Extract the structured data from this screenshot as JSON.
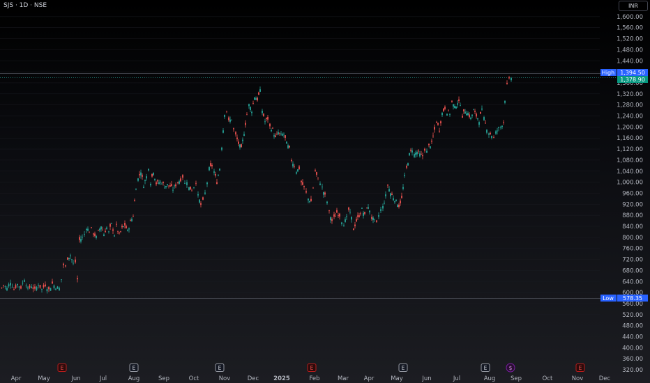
{
  "header": {
    "title": "SJS · 1D · NSE",
    "currency": "INR"
  },
  "colors": {
    "up": "#26a69a",
    "down": "#ef5350",
    "high_tag": "#2962ff",
    "last_tag": "#089981",
    "event_earn": "#b71c1c",
    "event_div": "#7b1fa2"
  },
  "chart_data": {
    "type": "candlestick",
    "ylim": [
      305,
      1635
    ],
    "y_ticks": [
      "320.00",
      "360.00",
      "400.00",
      "440.00",
      "480.00",
      "520.00",
      "560.00",
      "600.00",
      "640.00",
      "680.00",
      "720.00",
      "760.00",
      "800.00",
      "840.00",
      "880.00",
      "920.00",
      "960.00",
      "1,000.00",
      "1,040.00",
      "1,080.00",
      "1,120.00",
      "1,160.00",
      "1,200.00",
      "1,240.00",
      "1,280.00",
      "1,320.00",
      "1,360.00",
      "1,400.00",
      "1,440.00",
      "1,480.00",
      "1,520.00",
      "1,560.00",
      "1,600.00"
    ],
    "x_ticks": [
      "Apr",
      "May",
      "Jun",
      "Jul",
      "Aug",
      "Sep",
      "Oct",
      "Nov",
      "Dec",
      "2025",
      "Feb",
      "Mar",
      "Apr",
      "May",
      "Jun",
      "Jul",
      "Aug",
      "Sep",
      "Oct",
      "Nov",
      "Dec"
    ],
    "high": {
      "label": "High",
      "value": "1,394.50"
    },
    "low": {
      "label": "Low",
      "value": "578.35"
    },
    "last": {
      "value": "1,378.90"
    },
    "events": [
      {
        "type": "earnings",
        "label": "E",
        "filled": true
      },
      {
        "type": "earnings",
        "label": "E",
        "filled": false
      },
      {
        "type": "earnings",
        "label": "E",
        "filled": false
      },
      {
        "type": "earnings",
        "label": "E",
        "filled": true
      },
      {
        "type": "earnings",
        "label": "E",
        "filled": false
      },
      {
        "type": "earnings",
        "label": "E",
        "filled": false
      },
      {
        "type": "dividend",
        "label": "$",
        "filled": true
      },
      {
        "type": "earnings",
        "label": "E",
        "filled": true
      }
    ],
    "series": [
      {
        "name": "",
        "values": [
          [
            0,
            605
          ],
          [
            5,
            628
          ],
          [
            10,
            615
          ],
          [
            15,
            640
          ],
          [
            20,
            612
          ],
          [
            25,
            630
          ],
          [
            30,
            618
          ],
          [
            35,
            650
          ],
          [
            40,
            612
          ],
          [
            45,
            625
          ],
          [
            50,
            608
          ],
          [
            55,
            630
          ],
          [
            60,
            612
          ],
          [
            65,
            628
          ],
          [
            70,
            610
          ],
          [
            75,
            632
          ],
          [
            80,
            620
          ],
          [
            85,
            615
          ],
          [
            88,
            648
          ],
          [
            91,
            700
          ],
          [
            94,
            692
          ],
          [
            97,
            725
          ],
          [
            101,
            735
          ],
          [
            105,
            705
          ],
          [
            108,
            710
          ],
          [
            111,
            648
          ],
          [
            114,
            790
          ],
          [
            118,
            800
          ],
          [
            121,
            812
          ],
          [
            124,
            836
          ],
          [
            128,
            822
          ],
          [
            131,
            830
          ],
          [
            134,
            815
          ],
          [
            138,
            800
          ],
          [
            141,
            820
          ],
          [
            145,
            842
          ],
          [
            149,
            812
          ],
          [
            153,
            835
          ],
          [
            156,
            818
          ],
          [
            160,
            848
          ],
          [
            164,
            810
          ],
          [
            167,
            840
          ],
          [
            171,
            808
          ],
          [
            175,
            832
          ],
          [
            179,
            845
          ],
          [
            183,
            822
          ],
          [
            187,
            855
          ],
          [
            191,
            880
          ],
          [
            195,
            980
          ],
          [
            198,
            1012
          ],
          [
            202,
            1040
          ],
          [
            206,
            990
          ],
          [
            210,
            1020
          ],
          [
            213,
            1055
          ],
          [
            216,
            1000
          ],
          [
            220,
            1040
          ],
          [
            224,
            995
          ],
          [
            228,
            1000
          ],
          [
            232,
            1000
          ],
          [
            236,
            985
          ],
          [
            240,
            990
          ],
          [
            244,
            985
          ],
          [
            248,
            975
          ],
          [
            252,
            990
          ],
          [
            255,
            1000
          ],
          [
            259,
            1010
          ],
          [
            262,
            1020
          ],
          [
            265,
            995
          ],
          [
            268,
            1005
          ],
          [
            271,
            980
          ],
          [
            275,
            972
          ],
          [
            278,
            985
          ],
          [
            281,
            1002
          ],
          [
            284,
            950
          ],
          [
            288,
            918
          ],
          [
            291,
            930
          ],
          [
            294,
            960
          ],
          [
            297,
            1000
          ],
          [
            300,
            1048
          ],
          [
            304,
            1060
          ],
          [
            307,
            1038
          ],
          [
            311,
            1000
          ],
          [
            315,
            1050
          ],
          [
            318,
            1130
          ],
          [
            322,
            1250
          ],
          [
            325,
            1260
          ],
          [
            328,
            1220
          ],
          [
            332,
            1230
          ],
          [
            335,
            1190
          ],
          [
            338,
            1170
          ],
          [
            342,
            1140
          ],
          [
            346,
            1120
          ],
          [
            350,
            1180
          ],
          [
            354,
            1245
          ],
          [
            357,
            1280
          ],
          [
            361,
            1260
          ],
          [
            365,
            1310
          ],
          [
            369,
            1300
          ],
          [
            373,
            1330
          ],
          [
            376,
            1260
          ],
          [
            380,
            1220
          ],
          [
            384,
            1230
          ],
          [
            387,
            1200
          ],
          [
            391,
            1190
          ],
          [
            395,
            1160
          ],
          [
            399,
            1180
          ],
          [
            403,
            1170
          ],
          [
            407,
            1175
          ],
          [
            411,
            1140
          ],
          [
            415,
            1120
          ],
          [
            418,
            1080
          ],
          [
            422,
            1060
          ],
          [
            425,
            1040
          ],
          [
            429,
            1050
          ],
          [
            432,
            1000
          ],
          [
            436,
            980
          ],
          [
            439,
            960
          ],
          [
            442,
            940
          ],
          [
            446,
            930
          ],
          [
            449,
            980
          ],
          [
            452,
            1040
          ],
          [
            456,
            1010
          ],
          [
            459,
            1000
          ],
          [
            462,
            980
          ],
          [
            466,
            950
          ],
          [
            469,
            930
          ],
          [
            472,
            890
          ],
          [
            476,
            860
          ],
          [
            479,
            870
          ],
          [
            483,
            890
          ],
          [
            487,
            880
          ],
          [
            490,
            860
          ],
          [
            493,
            850
          ],
          [
            497,
            870
          ],
          [
            500,
            900
          ],
          [
            504,
            870
          ],
          [
            507,
            830
          ],
          [
            511,
            860
          ],
          [
            515,
            880
          ],
          [
            519,
            900
          ],
          [
            523,
            880
          ],
          [
            526,
            910
          ],
          [
            530,
            900
          ],
          [
            533,
            870
          ],
          [
            537,
            860
          ],
          [
            540,
            850
          ],
          [
            543,
            880
          ],
          [
            546,
            900
          ],
          [
            549,
            910
          ],
          [
            553,
            950
          ],
          [
            556,
            990
          ],
          [
            560,
            960
          ],
          [
            564,
            945
          ],
          [
            568,
            930
          ],
          [
            572,
            915
          ],
          [
            576,
            940
          ],
          [
            580,
            1020
          ],
          [
            583,
            1050
          ],
          [
            587,
            1100
          ],
          [
            591,
            1120
          ],
          [
            594,
            1100
          ],
          [
            598,
            1110
          ],
          [
            602,
            1100
          ],
          [
            606,
            1095
          ],
          [
            609,
            1120
          ],
          [
            612,
            1110
          ],
          [
            615,
            1130
          ],
          [
            619,
            1140
          ],
          [
            623,
            1190
          ],
          [
            626,
            1220
          ],
          [
            630,
            1190
          ],
          [
            634,
            1250
          ],
          [
            638,
            1270
          ],
          [
            641,
            1255
          ],
          [
            645,
            1250
          ],
          [
            648,
            1290
          ],
          [
            652,
            1270
          ],
          [
            656,
            1290
          ],
          [
            660,
            1285
          ],
          [
            663,
            1240
          ],
          [
            667,
            1260
          ],
          [
            671,
            1250
          ],
          [
            675,
            1230
          ],
          [
            679,
            1260
          ],
          [
            683,
            1240
          ],
          [
            687,
            1225
          ],
          [
            691,
            1260
          ],
          [
            694,
            1230
          ],
          [
            698,
            1195
          ],
          [
            701,
            1180
          ],
          [
            705,
            1170
          ],
          [
            708,
            1160
          ],
          [
            711,
            1180
          ],
          [
            715,
            1195
          ],
          [
            718,
            1200
          ],
          [
            722,
            1220
          ],
          [
            724,
            1300
          ],
          [
            727,
            1350
          ],
          [
            730,
            1370
          ],
          [
            733,
            1378.9
          ]
        ]
      }
    ]
  }
}
